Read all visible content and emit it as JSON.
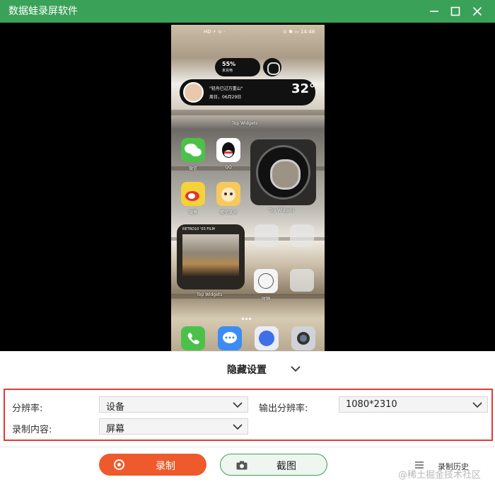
{
  "window": {
    "title": "数据蛙录屏软件",
    "accent": "#3aa159",
    "icons": {
      "minimize": "minimize-icon",
      "maximize": "maximize-icon",
      "close": "close-icon"
    }
  },
  "preview": {
    "status_left": "HD ⚡ ⊙ ·",
    "status_right": "⊙ ✱ ▭ 14:48",
    "battery_pill": {
      "percent": "55%",
      "sub": "未充电"
    },
    "music_widget": {
      "title": "\"轻舟已过万重山\"",
      "date": "周日，06月29日",
      "temp": "32°"
    },
    "widget_label_top": "Top Widgets",
    "apps": [
      {
        "label": "微信"
      },
      {
        "label": "QQ"
      },
      {
        "label": "微博"
      },
      {
        "label": "蛋仔派对"
      },
      {
        "label": "Top Widgets"
      }
    ],
    "photo_widget_caption": "RETRO10 '03 FILM",
    "photo_widget_label": "Top Widgets",
    "clock_label": "时钟"
  },
  "settings": {
    "toggle_label": "隐藏设置",
    "resolution_label": "分辨率:",
    "resolution_value": "设备",
    "output_resolution_label": "输出分辨率:",
    "output_resolution_value": "1080*2310",
    "content_label": "录制内容:",
    "content_value": "屏幕",
    "highlight_color": "#e53935"
  },
  "actions": {
    "record_label": "录制",
    "record_color": "#ee5a2c",
    "screenshot_label": "截图",
    "history_label": "录制历史"
  },
  "watermark": "@稀土掘金技术社区"
}
